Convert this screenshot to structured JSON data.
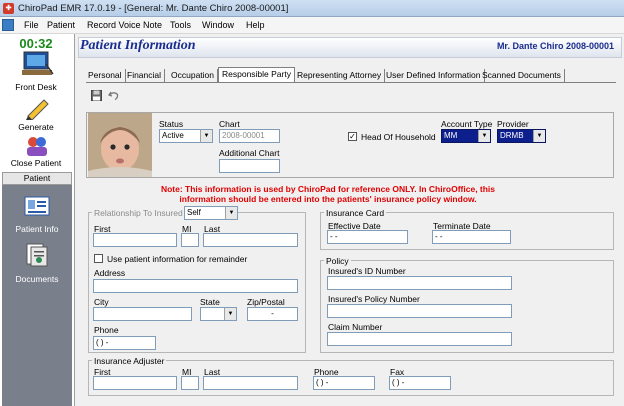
{
  "app": {
    "title": "ChiroPad EMR  17.0.19 - [General:  Mr. Dante Chiro 2008-00001]"
  },
  "menu": {
    "file": "File",
    "patient": "Patient",
    "record": "Record Voice Note",
    "tools": "Tools",
    "window": "Window",
    "help": "Help"
  },
  "sidebar": {
    "timer": "00:32",
    "front_desk": "Front Desk",
    "generate": "Generate",
    "close_patient": "Close Patient",
    "section": "Patient",
    "patient_info": "Patient Info",
    "documents": "Documents"
  },
  "header": {
    "title": "Patient Information",
    "patient": "Mr. Dante Chiro 2008-00001"
  },
  "tabs": [
    "Personal",
    "Financial",
    "Occupation",
    "Responsible Party",
    "Representing Attorney",
    "User Defined Information",
    "Scanned Documents"
  ],
  "top": {
    "status_label": "Status",
    "status_value": "Active",
    "chart_label": "Chart",
    "chart_value": "2008-00001",
    "additional_chart_label": "Additional Chart",
    "head_of_household": "Head Of Household",
    "account_type_label": "Account Type",
    "account_type_value": "MM",
    "provider_label": "Provider",
    "provider_value": "DRMB"
  },
  "note": {
    "line1": "Note:  This information is used by ChiroPad for reference ONLY. In ChiroOffice, this",
    "line2": "information should be entered into the patients' insurance policy window."
  },
  "insured": {
    "relationship_label": "Relationship To Insured",
    "relationship_value": "Self",
    "first": "First",
    "mi": "MI",
    "last": "Last",
    "use_patient_info": "Use patient information for remainder",
    "address": "Address",
    "city": "City",
    "state": "State",
    "zip": "Zip/Postal",
    "zip_value": "-",
    "phone": "Phone",
    "phone_value": "(  )   -"
  },
  "card": {
    "title": "Insurance Card",
    "effective": "Effective Date",
    "effective_value": " -  -",
    "terminate": "Terminate Date",
    "terminate_value": " -  -"
  },
  "policy": {
    "title": "Policy",
    "id": "Insured's ID Number",
    "number": "Insured's Policy Number",
    "claim": "Claim Number"
  },
  "adjuster": {
    "title": "Insurance Adjuster",
    "first": "First",
    "mi": "MI",
    "last": "Last",
    "phone": "Phone",
    "phone_value": "(  )   -",
    "fax": "Fax",
    "fax_value": "(  )   -"
  }
}
